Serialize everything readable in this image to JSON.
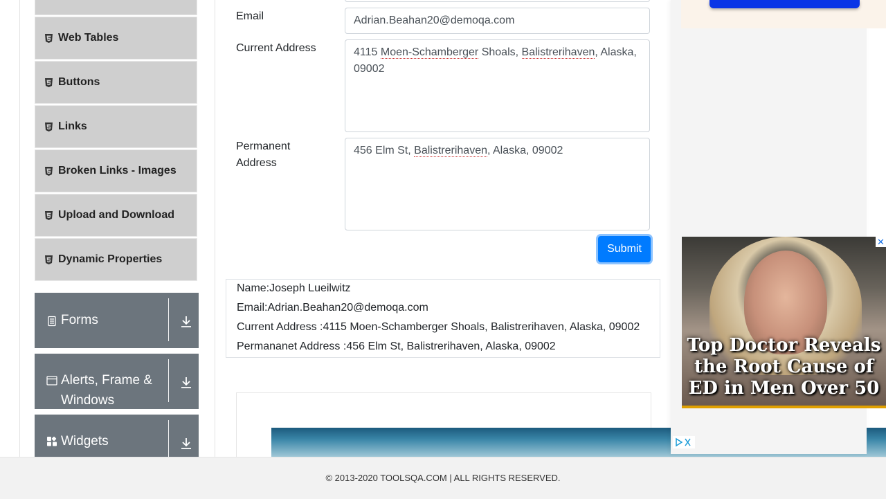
{
  "sidebar": {
    "items": [
      {
        "label": "Web Tables",
        "icon": "html5-icon"
      },
      {
        "label": "Buttons",
        "icon": "html5-icon"
      },
      {
        "label": "Links",
        "icon": "html5-icon"
      },
      {
        "label": "Broken Links - Images",
        "icon": "html5-icon"
      },
      {
        "label": "Upload and Download",
        "icon": "html5-icon"
      },
      {
        "label": "Dynamic Properties",
        "icon": "html5-icon"
      }
    ],
    "groups": [
      {
        "label": "Forms",
        "icon": "form-icon"
      },
      {
        "label": "Alerts, Frame & Windows",
        "icon": "window-icon"
      },
      {
        "label": "Widgets",
        "icon": "widgets-icon"
      }
    ]
  },
  "form": {
    "email_label": "Email",
    "email_value": "Adrian.Beahan20@demoqa.com",
    "current_address_label": "Current Address",
    "current_address_parts": [
      "4115 ",
      "Moen-Schamberger",
      " Shoals, ",
      "Balistrerihaven",
      ", Alaska, 09002"
    ],
    "permanent_address_label": "Permanent Address",
    "permanent_address_parts": [
      "456 Elm St, ",
      "Balistrerihaven",
      ", Alaska, 09002"
    ],
    "submit_label": "Submit"
  },
  "output": {
    "name": "Name:Joseph Lueilwitz",
    "email": "Email:Adrian.Beahan20@demoqa.com",
    "current_address": "Current Address :4115 Moen-Schamberger Shoals, Balistrerihaven, Alaska, 09002",
    "permanent_address": "Permananet Address :456 Elm St, Balistrerihaven, Alaska, 09002"
  },
  "ad": {
    "headline": "Top Doctor Reveals the Root Cause of ED in Men Over 50",
    "close_label": "✕"
  },
  "footer": {
    "text": "© 2013-2020 TOOLSQA.COM | ALL RIGHTS RESERVED."
  },
  "colors": {
    "accent": "#007bff",
    "sidebar_item_bg": "#cfcfcf",
    "group_bg": "#6c757d"
  }
}
